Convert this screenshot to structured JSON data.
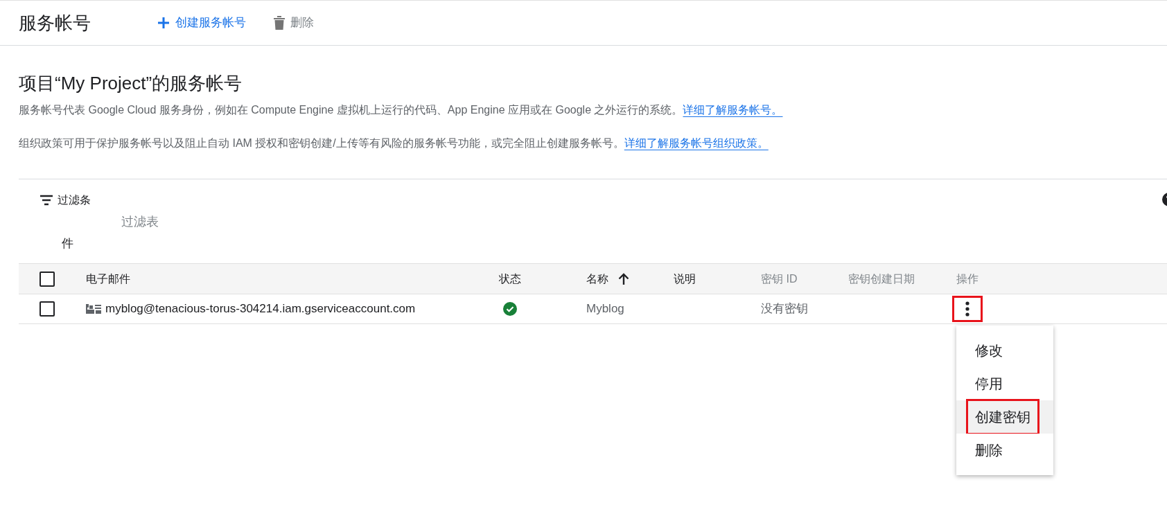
{
  "header": {
    "title": "服务帐号",
    "actions": [
      {
        "kind": "create",
        "label": "创建服务帐号",
        "disabled": false
      },
      {
        "kind": "delete",
        "label": "删除",
        "disabled": true
      }
    ]
  },
  "section": {
    "title": "项目“My Project”的服务帐号",
    "paragraphs": [
      {
        "text": "服务帐号代表 Google Cloud 服务身份，例如在 Compute Engine 虚拟机上运行的代码、App Engine 应用或在 Google 之外运行的系统。",
        "link": "详细了解服务帐号。"
      },
      {
        "text": "组织政策可用于保护服务帐号以及阻止自动 IAM 授权和密钥创建/上传等有风险的服务帐号功能，或完全阻止创建服务帐号。",
        "link": "详细了解服务帐号组织政策。"
      }
    ]
  },
  "filter": {
    "label": "过滤条",
    "label_wrap": "件",
    "placeholder": "过滤表"
  },
  "table": {
    "header_checked": false,
    "columns": [
      {
        "label": "电子邮件",
        "muted": false
      },
      {
        "label": "状态",
        "muted": false
      },
      {
        "label": "名称",
        "muted": false,
        "sorted": true
      },
      {
        "label": "说明",
        "muted": false
      },
      {
        "label": "密钥 ID",
        "muted": true
      },
      {
        "label": "密钥创建日期",
        "muted": true
      },
      {
        "label": "操作",
        "muted": true
      }
    ],
    "rows": [
      {
        "checked": false,
        "email": "myblog@tenacious-torus-304214.iam.gserviceaccount.com",
        "enabled": true,
        "name": "Myblog",
        "key_id": "没有密钥",
        "menu_annotated": true
      }
    ]
  },
  "menu": {
    "items": [
      {
        "label": "修改",
        "selected": false,
        "annotated": false
      },
      {
        "label": "停用",
        "selected": false,
        "annotated": false
      },
      {
        "label": "创建密钥",
        "selected": true,
        "annotated": true
      },
      {
        "label": "删除",
        "selected": false,
        "annotated": false
      }
    ]
  }
}
